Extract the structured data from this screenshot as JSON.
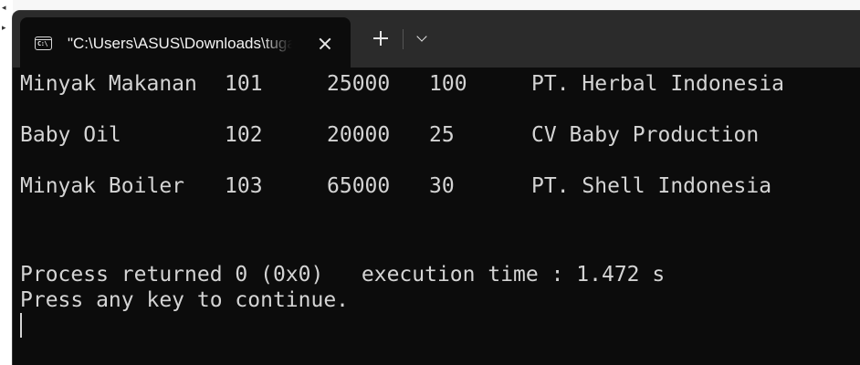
{
  "window": {
    "tab_title": "\"C:\\Users\\ASUS\\Downloads\\tugas.exe\"",
    "tab_icon_text": "C:\\",
    "tab_icon": "console-icon",
    "close_icon": "close-icon",
    "new_tab_icon": "plus-icon",
    "dropdown_icon": "chevron-down-icon"
  },
  "background": {
    "arrow_glyphs": [
      "◂",
      "▸"
    ]
  },
  "console": {
    "rows": [
      {
        "name": "Minyak Makanan",
        "code": "101",
        "price": "25000",
        "qty": "100",
        "supplier": "PT. Herbal Indonesia"
      },
      {
        "name": "Baby Oil",
        "code": "102",
        "price": "20000",
        "qty": "25",
        "supplier": "CV Baby Production"
      },
      {
        "name": "Minyak Boiler",
        "code": "103",
        "price": "65000",
        "qty": "30",
        "supplier": "PT. Shell Indonesia"
      }
    ],
    "process_line": "Process returned 0 (0x0)   execution time : 1.472 s",
    "continue_line": "Press any key to continue."
  },
  "colors": {
    "console_bg": "#0c0c0c",
    "console_text": "#d4d4d4",
    "titlebar_bg": "#2b2b2b"
  }
}
